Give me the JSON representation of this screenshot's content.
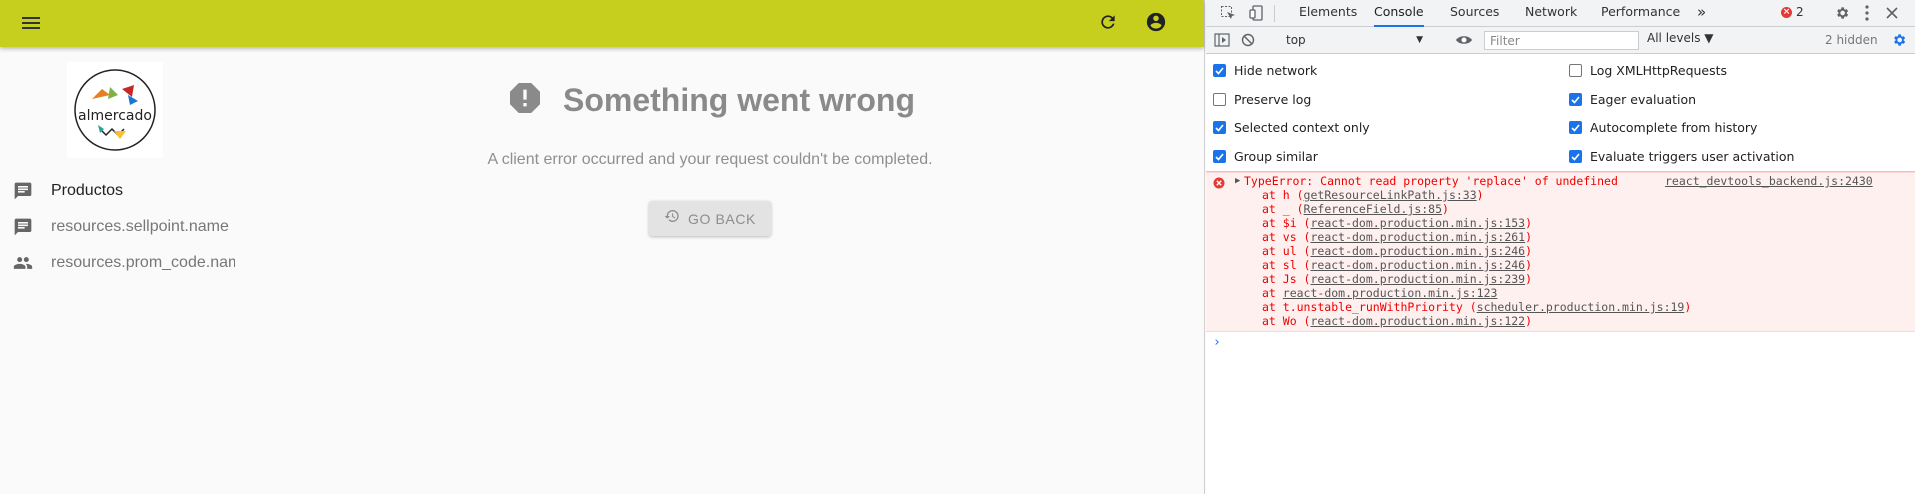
{
  "app": {
    "logo_text": "almercado",
    "nav": [
      {
        "label": "Productos",
        "icon": "chat-icon",
        "active": true
      },
      {
        "label": "resources.sellpoint.name",
        "icon": "chat-icon",
        "active": false
      },
      {
        "label": "resources.prom_code.name",
        "icon": "people-icon",
        "active": false
      }
    ],
    "error": {
      "title": "Something went wrong",
      "subtitle": "A client error occurred and your request couldn't be completed.",
      "button": "GO BACK"
    },
    "colors": {
      "appbar": "#c6cf1e",
      "background": "#fafafa"
    }
  },
  "devtools": {
    "tabs": [
      "Elements",
      "Console",
      "Sources",
      "Network",
      "Performance"
    ],
    "active_tab": "Console",
    "more_tabs": "»",
    "error_count": "2",
    "toolbar": {
      "context": "top",
      "filter_placeholder": "Filter",
      "levels": "All levels ▼",
      "hidden": "2 hidden"
    },
    "settings": [
      {
        "label": "Hide network",
        "checked": true
      },
      {
        "label": "Log XMLHttpRequests",
        "checked": false
      },
      {
        "label": "Preserve log",
        "checked": false
      },
      {
        "label": "Eager evaluation",
        "checked": true
      },
      {
        "label": "Selected context only",
        "checked": true
      },
      {
        "label": "Autocomplete from history",
        "checked": true
      },
      {
        "label": "Group similar",
        "checked": true
      },
      {
        "label": "Evaluate triggers user activation",
        "checked": true
      }
    ],
    "error": {
      "message": "TypeError: Cannot read property 'replace' of undefined",
      "source": "react_devtools_backend.js:2430",
      "frames": [
        {
          "fn": "at h (",
          "link": "getResourceLinkPath.js:33",
          "end": ")"
        },
        {
          "fn": "at _ (",
          "link": "ReferenceField.js:85",
          "end": ")"
        },
        {
          "fn": "at $i (",
          "link": "react-dom.production.min.js:153",
          "end": ")"
        },
        {
          "fn": "at vs (",
          "link": "react-dom.production.min.js:261",
          "end": ")"
        },
        {
          "fn": "at ul (",
          "link": "react-dom.production.min.js:246",
          "end": ")"
        },
        {
          "fn": "at sl (",
          "link": "react-dom.production.min.js:246",
          "end": ")"
        },
        {
          "fn": "at Js (",
          "link": "react-dom.production.min.js:239",
          "end": ")"
        },
        {
          "fn": "at ",
          "link": "react-dom.production.min.js:123",
          "end": ""
        },
        {
          "fn": "at t.unstable_runWithPriority (",
          "link": "scheduler.production.min.js:19",
          "end": ")"
        },
        {
          "fn": "at Wo (",
          "link": "react-dom.production.min.js:122",
          "end": ")"
        }
      ]
    },
    "prompt": "›"
  }
}
